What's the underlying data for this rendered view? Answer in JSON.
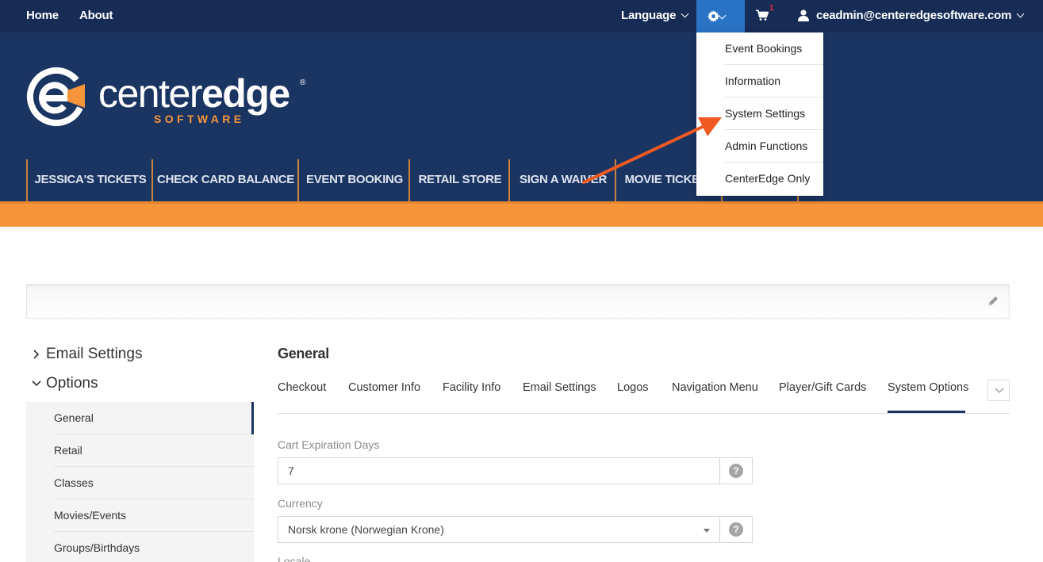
{
  "topbar": {
    "home": "Home",
    "about": "About",
    "language": "Language",
    "cart_count": "1",
    "user_email": "ceadmin@centeredgesoftware.com"
  },
  "logo": {
    "word_light": "center",
    "word_bold": "edge",
    "reg": "®",
    "sub": "SOFTWARE"
  },
  "nav": {
    "tabs": [
      "JESSICA'S TICKETS",
      "CHECK CARD BALANCE",
      "EVENT BOOKING",
      "RETAIL STORE",
      "SIGN A WAIVER",
      "MOVIE TICKETS",
      ""
    ]
  },
  "settings_menu": {
    "items": [
      "Event Bookings",
      "Information",
      "System Settings",
      "Admin Functions",
      "CenterEdge Only"
    ]
  },
  "sidebar": {
    "sections": [
      {
        "label": "Email Settings",
        "expanded": false
      },
      {
        "label": "Options",
        "expanded": true
      }
    ],
    "items": [
      "General",
      "Retail",
      "Classes",
      "Movies/Events",
      "Groups/Birthdays"
    ],
    "active": "General"
  },
  "main": {
    "title": "General",
    "tabs": [
      "Checkout",
      "Customer Info",
      "Facility Info",
      "Email Settings",
      "Logos",
      "Navigation Menu",
      "Player/Gift Cards",
      "System Options"
    ],
    "active_tab": "System Options",
    "fields": {
      "cart_expiration": {
        "label": "Cart Expiration Days",
        "value": "7"
      },
      "currency": {
        "label": "Currency",
        "value": "Norsk krone (Norwegian Krone)"
      },
      "locale": {
        "label": "Locale"
      }
    },
    "help_glyph": "?"
  },
  "colors": {
    "topbar": "#162c55",
    "header": "#1b3563",
    "accent_orange": "#f6953a",
    "gear_active": "#2a72c4",
    "arrow": "#f05a22"
  }
}
